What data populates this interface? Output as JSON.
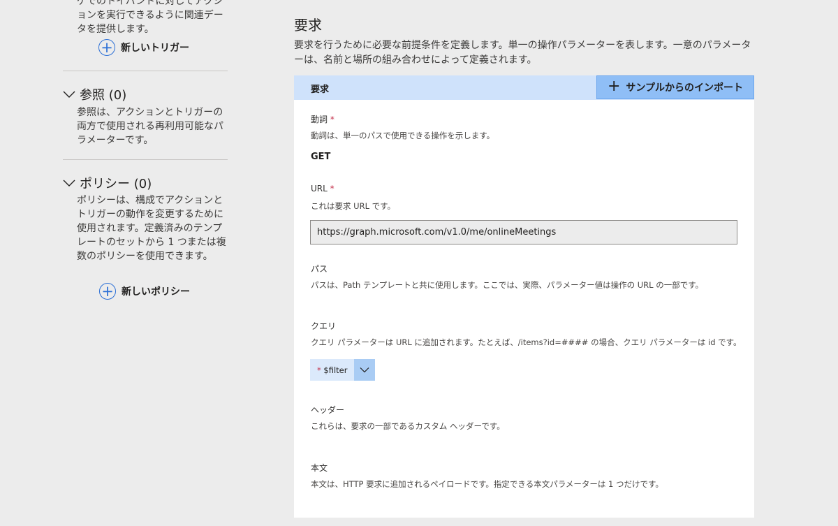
{
  "left": {
    "triggers_desc_tail": "ゲでのトイバンドに対してアクションを実行できるように関連データを提供します。",
    "new_trigger_label": "新しいトリガー",
    "references": {
      "title": "参照 (0)",
      "desc": "参照は、アクションとトリガーの両方で使用される再利用可能なパラメーターです。"
    },
    "policies": {
      "title": "ポリシー (0)",
      "desc": "ポリシーは、構成でアクションとトリガーの動作を変更するために使用されます。定義済みのテンプレートのセットから 1 つまたは複数のポリシーを使用できます。",
      "new_policy_label": "新しいポリシー"
    }
  },
  "request": {
    "title": "要求",
    "desc": "要求を行うために必要な前提条件を定義します。単一の操作パラメーターを表します。一意のパラメーターは、名前と場所の組み合わせによって定義されます。",
    "header_label": "要求",
    "import_label": "サンプルからのインポート",
    "verb": {
      "label": "動詞",
      "required": "*",
      "desc": "動詞は、単一のパスで使用できる操作を示します。",
      "value": "GET"
    },
    "url": {
      "label": "URL",
      "required": "*",
      "desc": "これは要求 URL です。",
      "value": "https://graph.microsoft.com/v1.0/me/onlineMeetings"
    },
    "path": {
      "label": "パス",
      "desc": "パスは、Path テンプレートと共に使用します。ここでは、実際、パラメーター値は操作の URL の一部です。"
    },
    "query": {
      "label": "クエリ",
      "desc": "クエリ パラメーターは URL に追加されます。たとえば、/items?id=#### の場合、クエリ パラメーターは id です。",
      "chip_required": "*",
      "chip_label": "$filter"
    },
    "headers": {
      "label": "ヘッダー",
      "desc": "これらは、要求の一部であるカスタム ヘッダーです。"
    },
    "body": {
      "label": "本文",
      "desc": "本文は、HTTP 要求に追加されるペイロードです。指定できる本文パラメーターは 1 つだけです。"
    }
  },
  "colors": {
    "accent": "#2b6fd6",
    "header_bg": "#cfe2fb",
    "import_bg": "#8fbef6",
    "required": "#c4314b"
  },
  "icons": {
    "add": "plus-circle-icon",
    "expand": "chevron-down-icon",
    "import": "plus-icon",
    "dropdown": "chevron-down-icon"
  }
}
